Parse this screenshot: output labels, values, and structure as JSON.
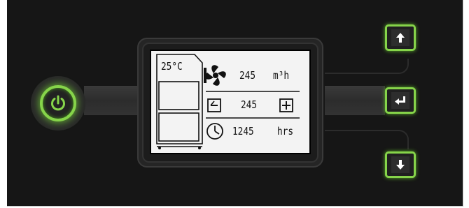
{
  "display": {
    "temperature": "25°C",
    "airflow_value": "245",
    "airflow_unit": "m³h",
    "setpoint_value": "245",
    "hours_value": "1245",
    "hours_unit": "hrs"
  },
  "icons": {
    "power": "power-icon",
    "up": "arrow-up-icon",
    "enter": "enter-icon",
    "down": "arrow-down-icon",
    "fan": "fan-icon",
    "decrease": "minus-icon",
    "increase": "plus-icon",
    "clock": "clock-icon"
  },
  "colors": {
    "accent": "#86d44a",
    "panel": "#161616",
    "screen": "#f3f3f3"
  }
}
